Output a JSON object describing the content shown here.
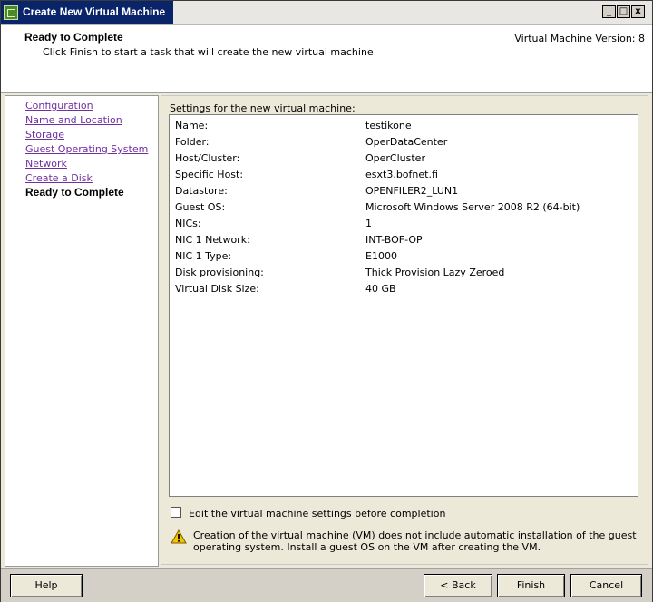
{
  "window": {
    "title": "Create New Virtual Machine",
    "controls": [
      "_",
      "□",
      "x"
    ]
  },
  "header": {
    "title": "Ready to Complete",
    "subtitle": "Click Finish to start a task that will create the new virtual machine",
    "version": "Virtual Machine Version: 8"
  },
  "sidebar": {
    "links": [
      "Configuration",
      "Name and Location",
      "Storage",
      "Guest Operating System",
      "Network",
      "Create a Disk"
    ],
    "current": "Ready to Complete"
  },
  "main": {
    "section_label": "Settings for the new virtual machine:",
    "settings": [
      {
        "key": "Name:",
        "value": "testikone"
      },
      {
        "key": "Folder:",
        "value": "OperDataCenter"
      },
      {
        "key": "Host/Cluster:",
        "value": "OperCluster"
      },
      {
        "key": "Specific Host:",
        "value": "esxt3.bofnet.fi"
      },
      {
        "key": "Datastore:",
        "value": "OPENFILER2_LUN1"
      },
      {
        "key": "Guest OS:",
        "value": "Microsoft Windows Server 2008 R2 (64-bit)"
      },
      {
        "key": "NICs:",
        "value": "1"
      },
      {
        "key": "NIC 1 Network:",
        "value": "INT-BOF-OP"
      },
      {
        "key": "NIC 1 Type:",
        "value": "E1000"
      },
      {
        "key": "Disk provisioning:",
        "value": "Thick Provision Lazy Zeroed"
      },
      {
        "key": "Virtual Disk Size:",
        "value": "40 GB"
      }
    ],
    "edit_checkbox_label": "Edit the virtual machine settings before completion",
    "edit_checkbox_checked": false,
    "warning_text": "Creation of the virtual machine (VM) does not include automatic installation of the guest operating system. Install a guest OS on the VM after creating the VM."
  },
  "footer": {
    "help": "Help",
    "back": "< Back",
    "finish": "Finish",
    "cancel": "Cancel"
  },
  "colors": {
    "title_bar": "#0a246a",
    "link": "#7030a0",
    "warning_icon": "#f5c400"
  }
}
